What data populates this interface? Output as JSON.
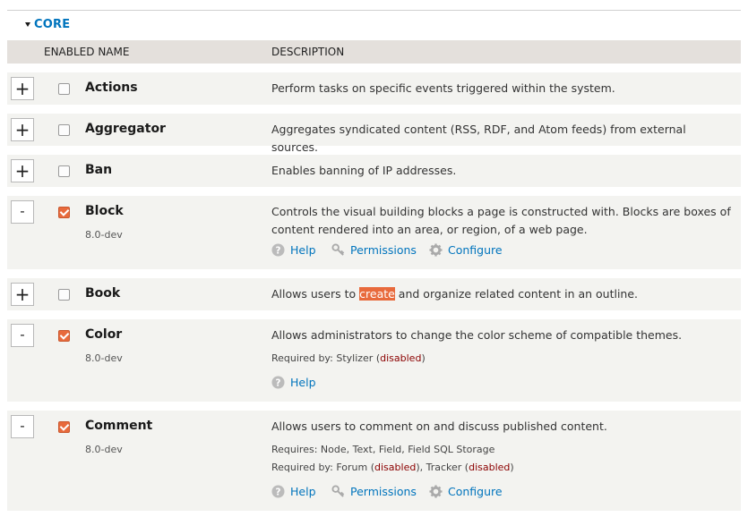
{
  "section": {
    "title": "CORE"
  },
  "table": {
    "col_enabled_name": "ENABLED NAME",
    "col_description": "DESCRIPTION"
  },
  "modules": [
    {
      "expander": "+",
      "name": "Actions",
      "enabled": false,
      "description": "Perform tasks on specific events triggered within the system."
    },
    {
      "expander": "+",
      "name": "Aggregator",
      "enabled": false,
      "description": "Aggregates syndicated content (RSS, RDF, and Atom feeds) from external sources."
    },
    {
      "expander": "+",
      "name": "Ban",
      "enabled": false,
      "description": "Enables banning of IP addresses."
    },
    {
      "expander": "-",
      "name": "Block",
      "enabled": true,
      "version": "8.0-dev",
      "description": "Controls the visual building blocks a page is constructed with. Blocks are boxes of content rendered into an area, or region, of a web page.",
      "links": {
        "help": "Help",
        "permissions": "Permissions",
        "configure": "Configure"
      }
    },
    {
      "expander": "+",
      "name": "Book",
      "enabled": false,
      "description_before": "Allows users to ",
      "description_highlight": "create",
      "description_after": " and organize related content in an outline."
    },
    {
      "expander": "-",
      "name": "Color",
      "enabled": true,
      "version": "8.0-dev",
      "description": "Allows administrators to change the color scheme of compatible themes.",
      "required_by_label": "Required by: Stylizer (",
      "required_by_status": "disabled",
      "required_by_close": ")",
      "links": {
        "help": "Help"
      }
    },
    {
      "expander": "-",
      "name": "Comment",
      "enabled": true,
      "version": "8.0-dev",
      "description": "Allows users to comment on and discuss published content.",
      "requires": "Requires: Node, Text, Field, Field SQL Storage",
      "required_by_1": "Required by: Forum (",
      "required_by_1_status": "disabled",
      "required_by_2": "), Tracker (",
      "required_by_2_status": "disabled",
      "required_by_close": ")",
      "links": {
        "help": "Help",
        "permissions": "Permissions",
        "configure": "Configure"
      }
    }
  ],
  "colors": {
    "link": "#0074bd",
    "checked": "#e86a3c",
    "disabled": "#8b0000",
    "header_bg": "#e4e0dc",
    "row_bg": "#f3f3f0"
  },
  "icons": {
    "help": "question-circle-icon",
    "permissions": "key-icon",
    "configure": "gear-icon"
  }
}
